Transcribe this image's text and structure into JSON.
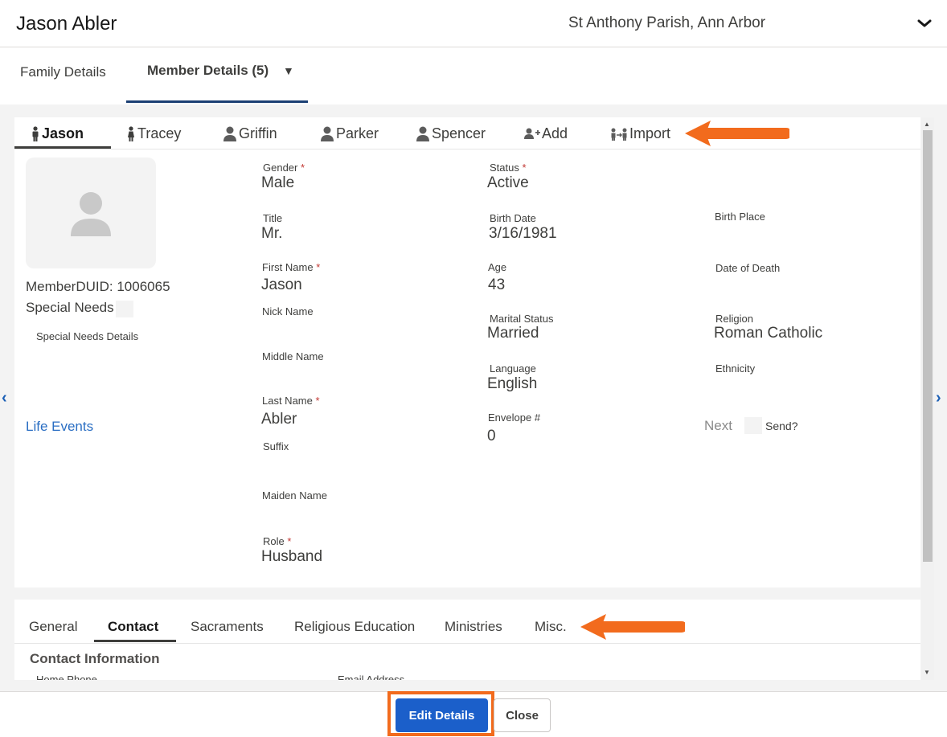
{
  "header": {
    "name": "Jason Abler",
    "parish": "St Anthony Parish, Ann Arbor"
  },
  "top_tabs": {
    "family": "Family Details",
    "member": "Member Details (5)",
    "caret": "▼"
  },
  "members": [
    {
      "label": "Jason",
      "icon": "male-icon"
    },
    {
      "label": "Tracey",
      "icon": "female-icon"
    },
    {
      "label": "Griffin",
      "icon": "person-icon"
    },
    {
      "label": "Parker",
      "icon": "person-icon"
    },
    {
      "label": "Spencer",
      "icon": "person-icon"
    },
    {
      "label": "Add",
      "icon": "add-person-icon"
    },
    {
      "label": "Import",
      "icon": "import-people-icon"
    }
  ],
  "left": {
    "member_duid": "MemberDUID: 1006065",
    "special_needs": "Special Needs",
    "special_needs_details": "Special Needs Details",
    "life_events": "Life Events"
  },
  "fields": {
    "gender": {
      "label": "Gender",
      "value": "Male",
      "required": "*"
    },
    "status": {
      "label": "Status",
      "value": "Active",
      "required": "*"
    },
    "title": {
      "label": "Title",
      "value": "Mr."
    },
    "birth_date": {
      "label": "Birth Date",
      "value": "3/16/1981"
    },
    "birth_place": {
      "label": "Birth Place",
      "value": ""
    },
    "first_name": {
      "label": "First Name",
      "value": "Jason",
      "required": "*"
    },
    "age": {
      "label": "Age",
      "value": "43"
    },
    "date_of_death": {
      "label": "Date of Death",
      "value": ""
    },
    "nick_name": {
      "label": "Nick Name",
      "value": ""
    },
    "marital_status": {
      "label": "Marital Status",
      "value": "Married"
    },
    "religion": {
      "label": "Religion",
      "value": "Roman Catholic"
    },
    "middle_name": {
      "label": "Middle Name",
      "value": ""
    },
    "language": {
      "label": "Language",
      "value": "English"
    },
    "ethnicity": {
      "label": "Ethnicity",
      "value": ""
    },
    "last_name": {
      "label": "Last Name",
      "value": "Abler",
      "required": "*"
    },
    "envelope": {
      "label": "Envelope #",
      "value": "0"
    },
    "suffix": {
      "label": "Suffix",
      "value": ""
    },
    "maiden_name": {
      "label": "Maiden Name",
      "value": ""
    },
    "role": {
      "label": "Role",
      "value": "Husband",
      "required": "*"
    }
  },
  "envelope_extra": {
    "next": "Next",
    "send": "Send?"
  },
  "bottom_tabs": [
    "General",
    "Contact",
    "Sacraments",
    "Religious Education",
    "Ministries",
    "Misc."
  ],
  "contact": {
    "title": "Contact Information",
    "home_phone_label": "Home Phone",
    "email_label": "Email Address"
  },
  "footer": {
    "edit": "Edit Details",
    "close": "Close"
  },
  "colors": {
    "accent_blue": "#1b5fca",
    "highlight_orange": "#f26b1d",
    "tab_underline": "#1b3f73",
    "required_red": "#c23934"
  }
}
